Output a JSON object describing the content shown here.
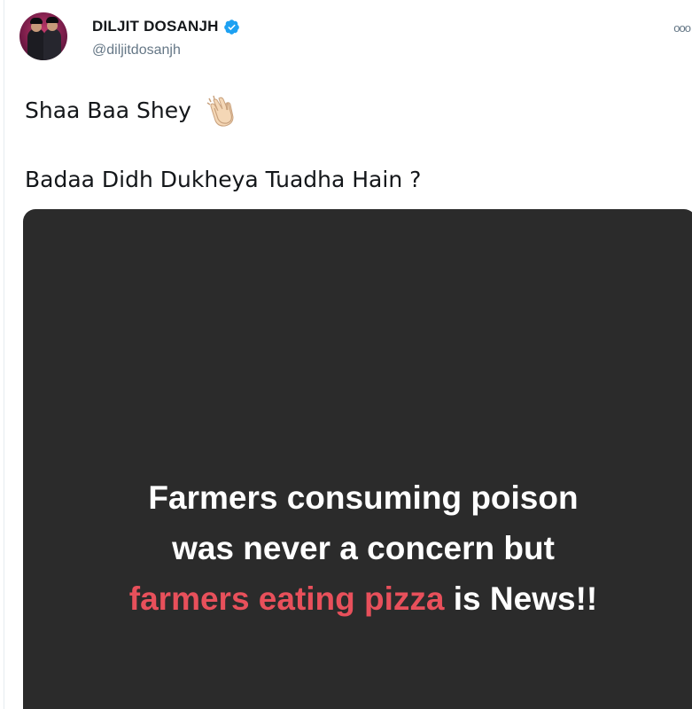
{
  "author": {
    "display_name": "DILJIT DOSANJH",
    "handle": "@diljitdosanjh",
    "verified": true,
    "verified_color": "#1da1f2"
  },
  "menu_icon": "more-options-icon",
  "more_label": "ooo",
  "tweet": {
    "line1": "Shaa Baa Shey",
    "line1_emoji": "clapping-hands-icon",
    "line2": "Badaa Didh Dukheya Tuadha Hain ?"
  },
  "media": {
    "background": "#2b2b2b",
    "text_line1": "Farmers consuming poison",
    "text_line2": "was never a concern but",
    "text_line3_highlight": "farmers eating pizza",
    "text_line3_rest": " is News!!",
    "highlight_color": "#e8505b"
  }
}
